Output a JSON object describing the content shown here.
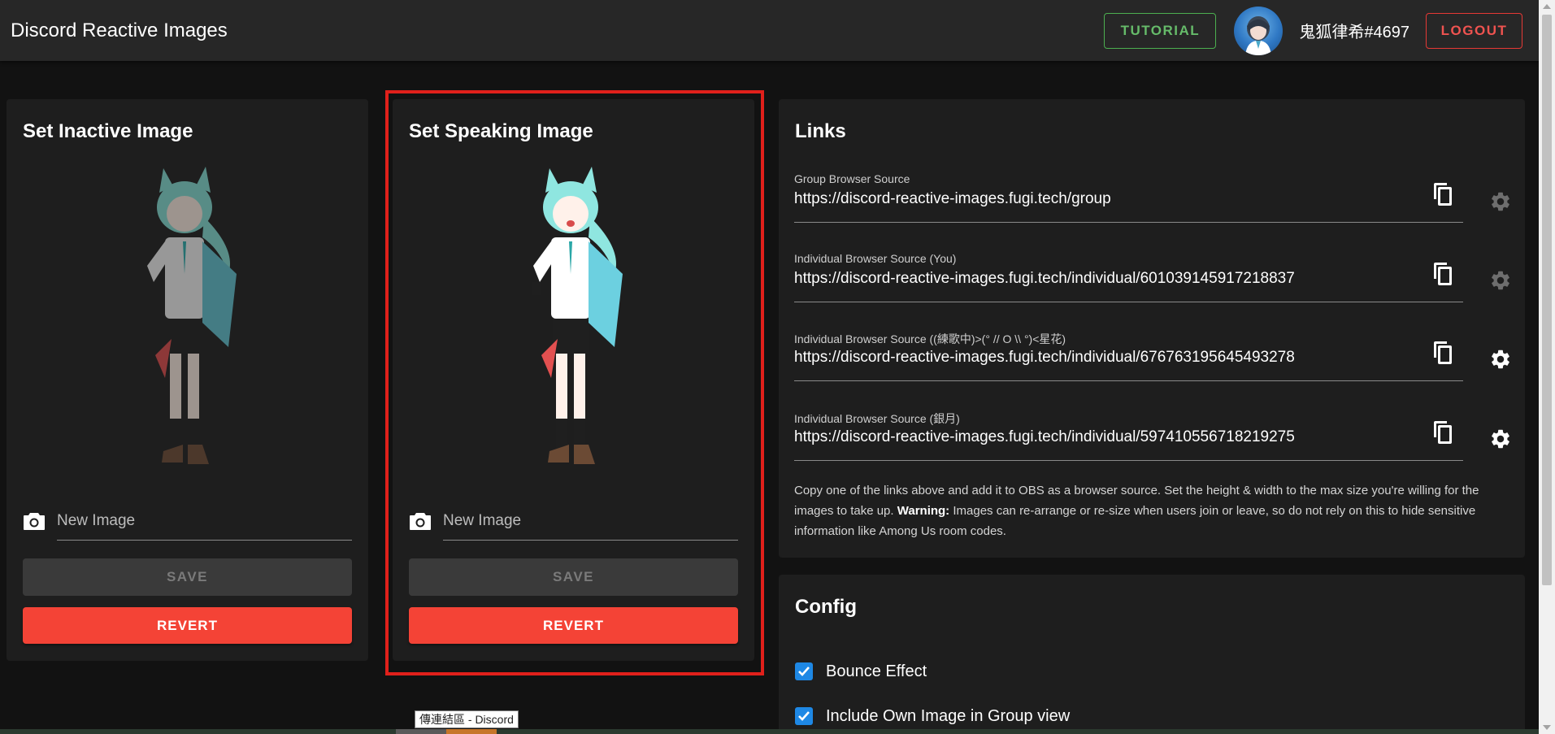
{
  "app": {
    "title": "Discord Reactive Images",
    "tutorial_label": "TUTORIAL",
    "username": "鬼狐律希#4697",
    "logout_label": "LOGOUT"
  },
  "inactive_card": {
    "title": "Set Inactive Image",
    "file_placeholder": "New Image",
    "save_label": "SAVE",
    "revert_label": "REVERT"
  },
  "speaking_card": {
    "title": "Set Speaking Image",
    "file_placeholder": "New Image",
    "save_label": "SAVE",
    "revert_label": "REVERT"
  },
  "links": {
    "title": "Links",
    "items": [
      {
        "label": "Group Browser Source",
        "url": "https://discord-reactive-images.fugi.tech/group"
      },
      {
        "label": "Individual Browser Source (You)",
        "url": "https://discord-reactive-images.fugi.tech/individual/601039145917218837"
      },
      {
        "label": "Individual Browser Source ((練歌中)>(° // Ο \\\\ °)<星花)",
        "url": "https://discord-reactive-images.fugi.tech/individual/676763195645493278"
      },
      {
        "label": "Individual Browser Source (銀月)",
        "url": "https://discord-reactive-images.fugi.tech/individual/597410556718219275"
      }
    ],
    "info_prefix": "Copy one of the links above and add it to OBS as a browser source. Set the height & width to the max size you're willing for the images to take up. ",
    "info_warning": "Warning:",
    "info_suffix": " Images can re-arrange or re-size when users join or leave, so do not rely on this to hide sensitive information like Among Us room codes."
  },
  "config": {
    "title": "Config",
    "options": [
      {
        "label": "Bounce Effect",
        "checked": true
      },
      {
        "label": "Include Own Image in Group view",
        "checked": true
      }
    ]
  },
  "tooltip": "傳連結區 - Discord",
  "colors": {
    "accent_red": "#f44336",
    "tutorial_green": "#66bb6a",
    "checkbox_blue": "#1e88e5",
    "highlight_red": "#e0201b"
  }
}
